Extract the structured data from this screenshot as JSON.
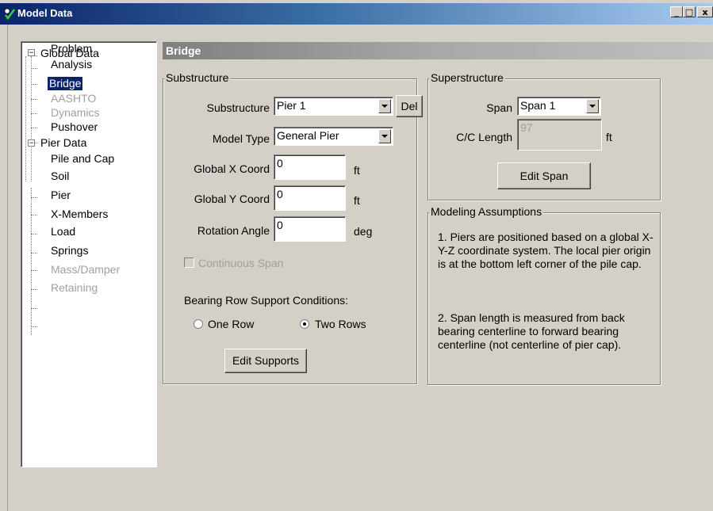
{
  "window": {
    "title": "Model Data",
    "buttons": {
      "minimize": "_",
      "maximize": "□",
      "close": "x"
    }
  },
  "tree": {
    "global": {
      "label": "Global Data",
      "expander": "−",
      "children": [
        "Problem",
        "Analysis",
        "Bridge",
        "AASHTO",
        "Dynamics",
        "Pushover"
      ]
    },
    "pier": {
      "label": "Pier Data",
      "expander": "−",
      "children": [
        "Pile and Cap",
        "Soil",
        "Pier",
        "X-Members",
        "Load",
        "Springs",
        "Mass/Damper",
        "Retaining"
      ]
    },
    "selected": "Bridge"
  },
  "header": {
    "title": "Bridge"
  },
  "substructure": {
    "legend": "Substructure",
    "substructure_label": "Substructure",
    "substructure_value": "Pier 1",
    "del_label": "Del",
    "model_type_label": "Model Type",
    "model_type_value": "General Pier",
    "global_x_label": "Global X Coord",
    "global_x_value": "0",
    "global_x_unit": "ft",
    "global_y_label": "Global Y Coord",
    "global_y_value": "0",
    "global_y_unit": "ft",
    "rotation_label": "Rotation Angle",
    "rotation_value": "0",
    "rotation_unit": "deg",
    "continuous_span_label": "Continuous Span",
    "bearing_label": "Bearing Row Support Conditions:",
    "one_row_label": "One Row",
    "two_rows_label": "Two Rows",
    "selected_bearing": "Two Rows",
    "edit_supports_label": "Edit Supports"
  },
  "superstructure": {
    "legend": "Superstructure",
    "span_label": "Span",
    "span_value": "Span 1",
    "cc_length_label": "C/C Length",
    "cc_length_value": "97",
    "cc_length_unit": "ft",
    "edit_span_label": "Edit Span"
  },
  "assumptions": {
    "legend": "Modeling Assumptions",
    "note1": "1. Piers are positioned based on a global X-Y-Z coordinate system. The local pier origin is at the bottom left corner of the pile cap.",
    "note2": "2. Span length is measured from back bearing centerline to forward bearing centerline (not centerline of pier cap)."
  },
  "colors": {
    "titlebar_start": "#0a246a",
    "titlebar_end": "#a6caf0",
    "face": "#d4d0c8",
    "selection": "#0a246a",
    "disabled_text": "#a0a0a0"
  },
  "icons": {
    "app": "app-icon",
    "tree_collapse": "minus-box-icon",
    "combo": "chevron-down-icon"
  }
}
